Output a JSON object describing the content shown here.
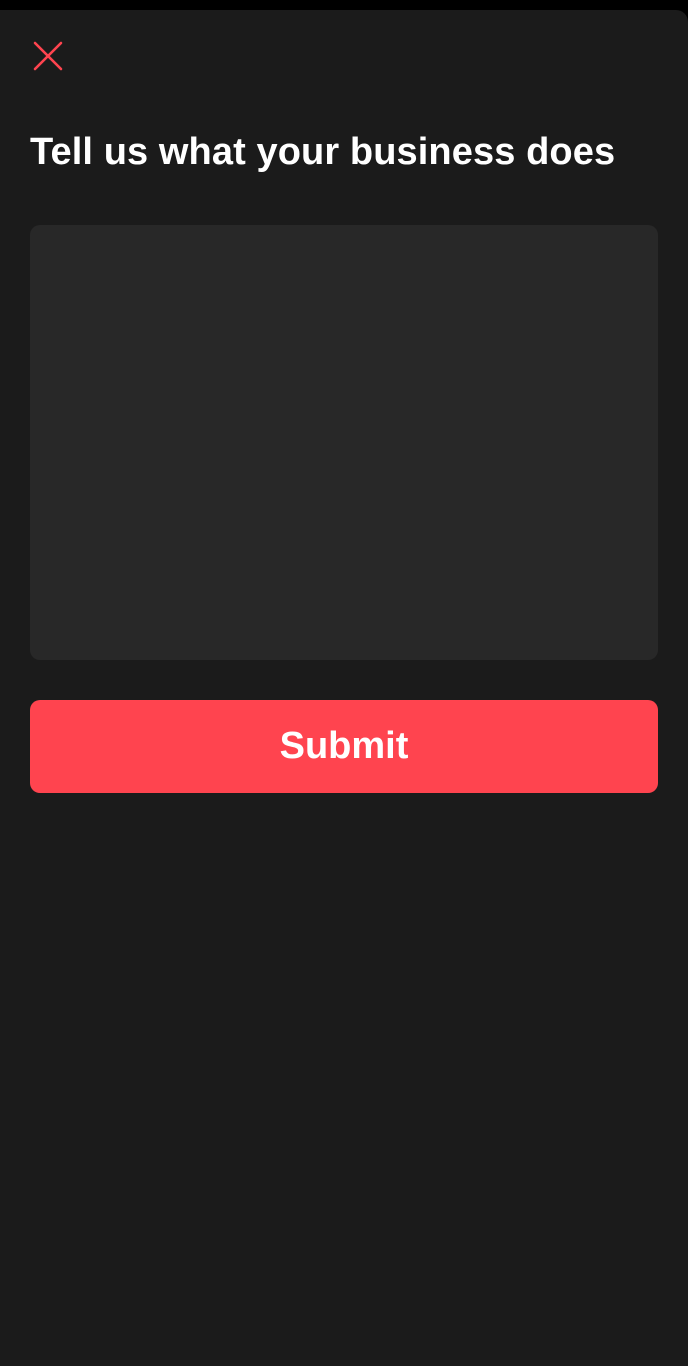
{
  "header": {
    "close_icon": "close-icon",
    "accent_color": "#ff444f"
  },
  "page": {
    "title": "Tell us what your business does"
  },
  "form": {
    "description_value": "",
    "description_placeholder": ""
  },
  "actions": {
    "submit_label": "Submit",
    "submit_color": "#ff444f"
  }
}
